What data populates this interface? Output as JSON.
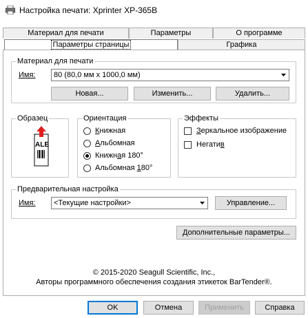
{
  "window": {
    "title": "Настройка печати: Xprinter XP-365B",
    "icon": "printer-icon"
  },
  "tabs": {
    "row1": [
      "Материал для печати",
      "Параметры",
      "О программе"
    ],
    "row2": [
      "Параметры страницы",
      "Графика"
    ],
    "active": "Параметры страницы"
  },
  "stock": {
    "group_label": "Материал для печати",
    "name_label": "Имя:",
    "name_value": "80 (80,0 мм x 1000,0 мм)",
    "new_button": "Новая...",
    "edit_button": "Изменить...",
    "delete_button": "Удалить..."
  },
  "preview": {
    "group_label": "Образец",
    "sample_text": "ALE"
  },
  "orientation": {
    "group_label": "Ориентация",
    "options": [
      "Книжная",
      "Альбомная",
      "Книжная 180°",
      "Альбомная 180°"
    ],
    "selected": "Книжная 180°"
  },
  "effects": {
    "group_label": "Эффекты",
    "mirror_label": "Зеркальное изображение",
    "mirror_checked": false,
    "negative_label": "Негатив",
    "negative_checked": false
  },
  "preset": {
    "group_label": "Предварительная настройка",
    "name_label": "Имя:",
    "name_value": "<Текущие настройки>",
    "manage_button": "Управление..."
  },
  "advanced_button": "Дополнительные параметры...",
  "copyright": {
    "line1": "© 2015-2020 Seagull Scientific, Inc.,",
    "line2": "Авторы программного обеспечения создания этикеток BarTender®."
  },
  "dialog_buttons": {
    "ok": "OK",
    "cancel": "Отмена",
    "apply": "Применить",
    "help": "Справка"
  },
  "colors": {
    "accent": "#0078d7",
    "arrow_red": "#e02020"
  }
}
